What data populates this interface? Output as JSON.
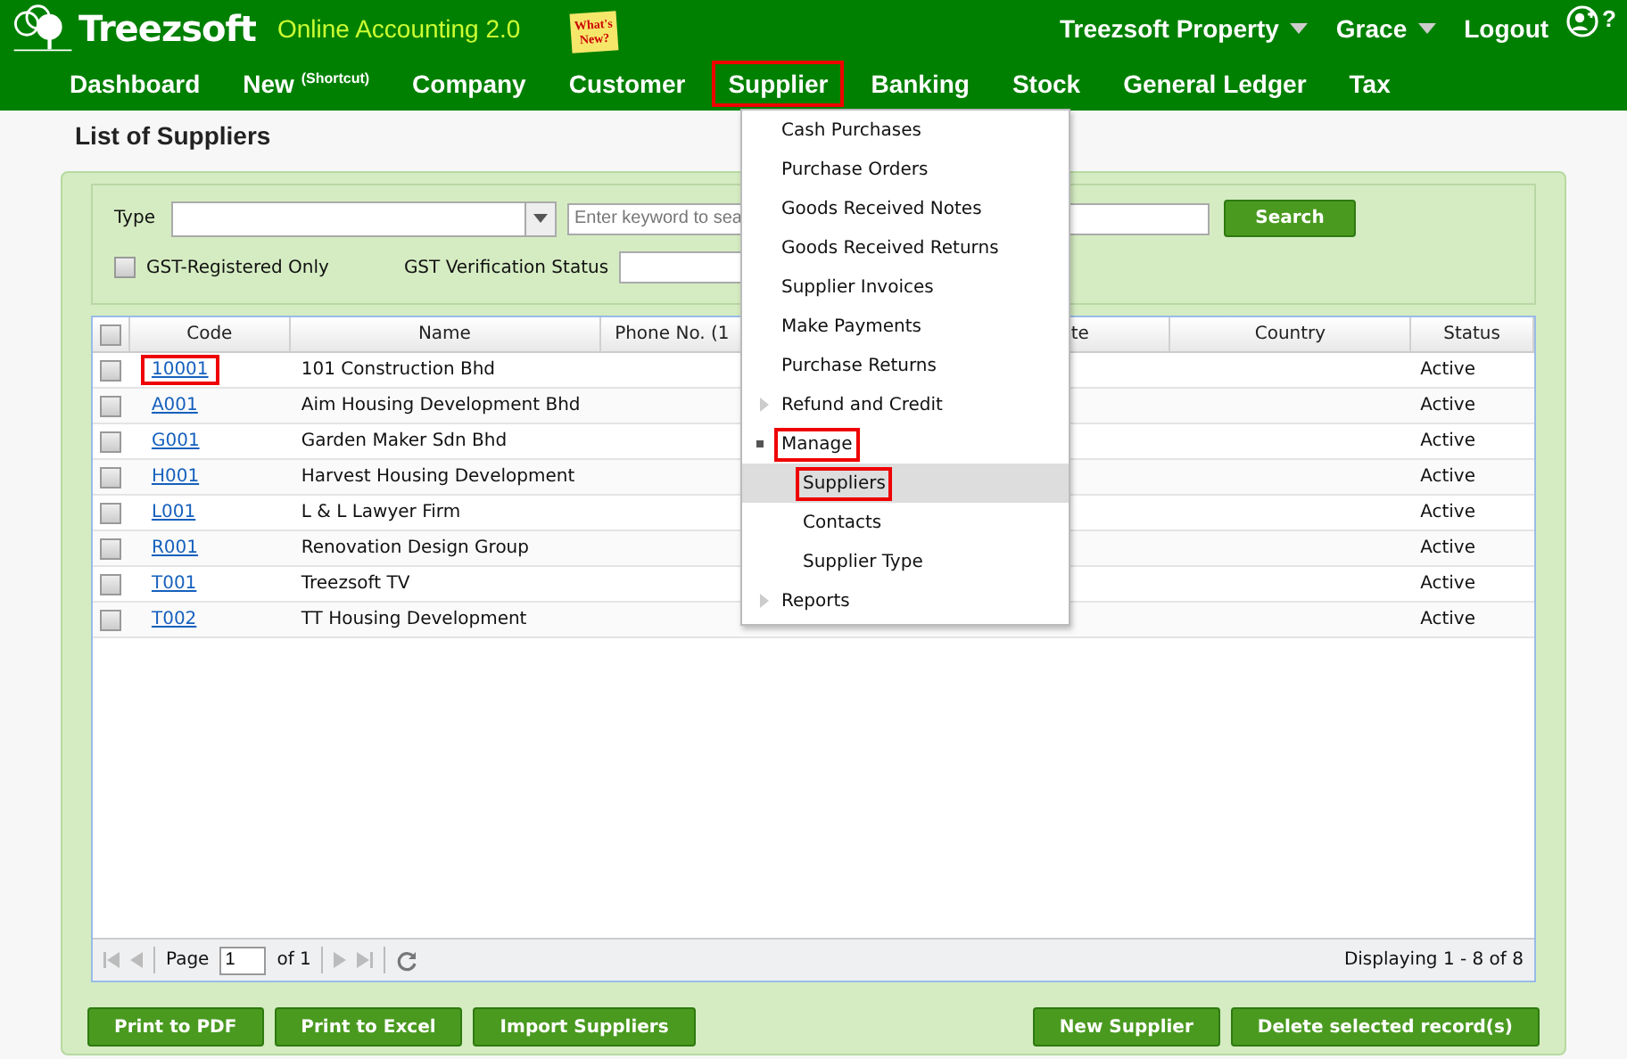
{
  "brand": {
    "name": "Treezsoft",
    "tagline": "Online Accounting 2.0",
    "note": "What's New?"
  },
  "user_menu": [
    {
      "label": "Treezsoft Property",
      "dropdown": true
    },
    {
      "label": "Grace",
      "dropdown": true
    },
    {
      "label": "Logout",
      "dropdown": false
    }
  ],
  "help": "?",
  "nav": [
    {
      "label": "Dashboard",
      "selected": false
    },
    {
      "label": "New $^{(Shortcut)}$",
      "selected": false
    },
    {
      "label": "Company",
      "selected": false
    },
    {
      "label": "Customer",
      "selected": false
    },
    {
      "label": "Supplier",
      "selected": true
    },
    {
      "label": "Banking",
      "selected": false
    },
    {
      "label": "Stock",
      "selected": false
    },
    {
      "label": "General Ledger",
      "selected": false
    },
    {
      "label": "Tax",
      "selected": false
    }
  ],
  "page_title": "List of Suppliers",
  "filters": {
    "type_label": "Type",
    "search_placeholder": "Enter keyword to sea",
    "search_button": "Search",
    "gst_only": {
      "label": "GST-Registered Only",
      "checked": false
    },
    "gst_status_label": "GST Verification Status"
  },
  "table": {
    "select_all_checked": false,
    "columns": [
      "Code",
      "Name",
      "Phone No. (1",
      "te",
      "Country",
      "Status"
    ],
    "rows": [
      {
        "checked": false,
        "code": "10001",
        "highlighted": true,
        "name": "101 Construction Bhd",
        "status": "Active"
      },
      {
        "checked": false,
        "code": "A001",
        "highlighted": false,
        "name": "Aim Housing Development Bhd",
        "status": "Active"
      },
      {
        "checked": false,
        "code": "G001",
        "highlighted": false,
        "name": "Garden Maker Sdn Bhd",
        "status": "Active"
      },
      {
        "checked": false,
        "code": "H001",
        "highlighted": false,
        "name": "Harvest Housing Development",
        "status": "Active"
      },
      {
        "checked": false,
        "code": "L001",
        "highlighted": false,
        "name": "L & L Lawyer Firm",
        "status": "Active"
      },
      {
        "checked": false,
        "code": "R001",
        "highlighted": false,
        "name": "Renovation Design Group",
        "status": "Active"
      },
      {
        "checked": false,
        "code": "T001",
        "highlighted": false,
        "name": "Treezsoft TV",
        "status": "Active"
      },
      {
        "checked": false,
        "code": "T002",
        "highlighted": false,
        "name": "TT Housing Development",
        "status": "Active"
      }
    ]
  },
  "pager": {
    "page_label": "Page",
    "page": "1",
    "of": "of 1",
    "display": "Displaying 1 - 8 of 8"
  },
  "buttons_left": [
    "Print to PDF",
    "Print to Excel",
    "Import Suppliers"
  ],
  "buttons_right": [
    "New Supplier",
    "Delete selected record(s)"
  ],
  "menu": [
    {
      "kind": "item",
      "label": "Cash Purchases"
    },
    {
      "kind": "item",
      "label": "Purchase Orders"
    },
    {
      "kind": "item",
      "label": "Goods Received Notes"
    },
    {
      "kind": "item",
      "label": "Goods Received Returns"
    },
    {
      "kind": "item",
      "label": "Supplier Invoices"
    },
    {
      "kind": "item",
      "label": "Make Payments"
    },
    {
      "kind": "item",
      "label": "Purchase Returns"
    },
    {
      "kind": "group",
      "label": "Refund and Credit",
      "expanded": false,
      "highlighted": false
    },
    {
      "kind": "group",
      "label": "Manage",
      "expanded": true,
      "highlighted": true,
      "children": [
        {
          "label": "Suppliers",
          "selected": true
        },
        {
          "label": "Contacts",
          "selected": false
        },
        {
          "label": "Supplier Type",
          "selected": false
        }
      ]
    },
    {
      "kind": "group",
      "label": "Reports",
      "expanded": false,
      "highlighted": false
    }
  ]
}
